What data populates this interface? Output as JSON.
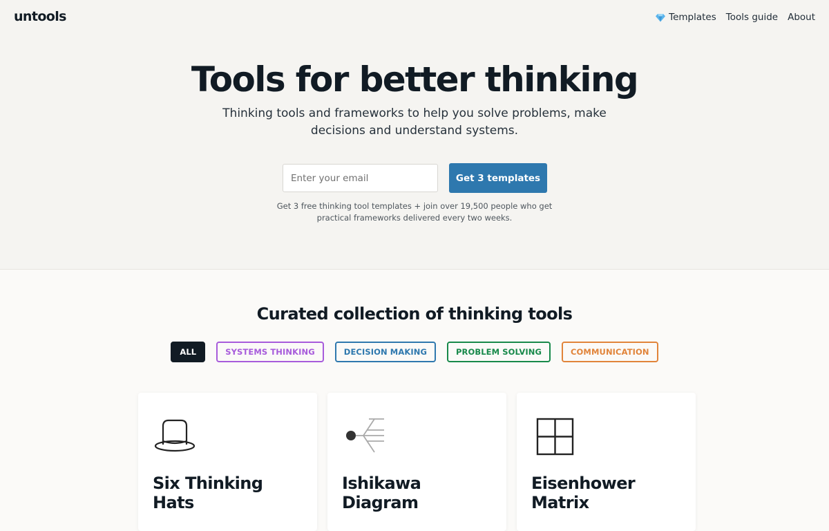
{
  "nav": {
    "logo": "untools",
    "links": [
      {
        "label": "Templates",
        "icon": "gem-icon"
      },
      {
        "label": "Tools guide"
      },
      {
        "label": "About"
      }
    ]
  },
  "hero": {
    "title": "Tools for better thinking",
    "subtitle": "Thinking tools and frameworks to help you solve problems, make decisions and understand systems.",
    "email_placeholder": "Enter your email",
    "cta_label": "Get 3 templates",
    "fine_print": "Get 3 free thinking tool templates + join over 19,500 people who get practical frameworks delivered every two weeks."
  },
  "collection": {
    "title": "Curated collection of thinking tools",
    "filters": [
      {
        "label": "ALL",
        "active": true
      },
      {
        "label": "SYSTEMS THINKING",
        "color": "#a75bdb"
      },
      {
        "label": "DECISION MAKING",
        "color": "#2e78ae"
      },
      {
        "label": "PROBLEM SOLVING",
        "color": "#17894a"
      },
      {
        "label": "COMMUNICATION",
        "color": "#e1843a"
      }
    ],
    "cards": [
      {
        "title": "Six Thinking Hats",
        "icon": "hat-icon"
      },
      {
        "title": "Ishikawa Diagram",
        "icon": "fishbone-icon"
      },
      {
        "title": "Eisenhower Matrix",
        "icon": "matrix-icon"
      }
    ]
  },
  "colors": {
    "hero_bg": "#f5f4f1",
    "page_bg": "#fbfaf8",
    "text": "#111b24",
    "cta": "#2e78ae"
  }
}
